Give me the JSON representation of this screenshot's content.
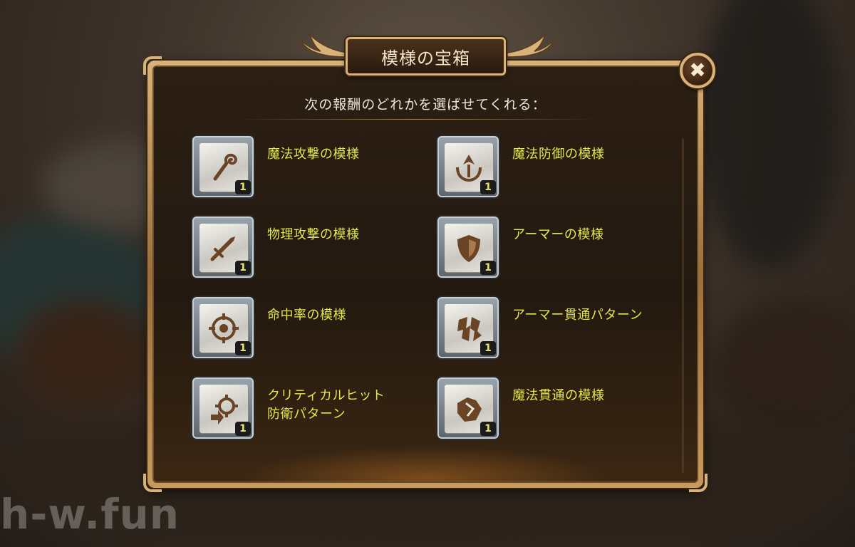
{
  "dialog": {
    "title": "模様の宝箱",
    "subtitle": "次の報酬のどれかを選ばせてくれる：",
    "close_label": "✖"
  },
  "rewards": [
    {
      "label": "魔法攻撃の模様",
      "qty": "1",
      "icon": "magic-staff-icon"
    },
    {
      "label": "魔法防御の模様",
      "qty": "1",
      "icon": "magic-defense-icon"
    },
    {
      "label": "物理攻撃の模様",
      "qty": "1",
      "icon": "sword-icon"
    },
    {
      "label": "アーマーの模様",
      "qty": "1",
      "icon": "shield-icon"
    },
    {
      "label": "命中率の模様",
      "qty": "1",
      "icon": "crosshair-icon"
    },
    {
      "label": "アーマー貫通パターン",
      "qty": "1",
      "icon": "armor-pierce-icon"
    },
    {
      "label": "クリティカルヒット\n防衛パターン",
      "qty": "1",
      "icon": "critical-defense-icon"
    },
    {
      "label": "魔法貫通の模様",
      "qty": "1",
      "icon": "magic-pierce-icon"
    }
  ],
  "watermark": "h-w.fun",
  "colors": {
    "label": "#e3e84a",
    "frame_gold": "#d9b27a",
    "panel": "#231910",
    "icon_brown": "#6a4424"
  }
}
